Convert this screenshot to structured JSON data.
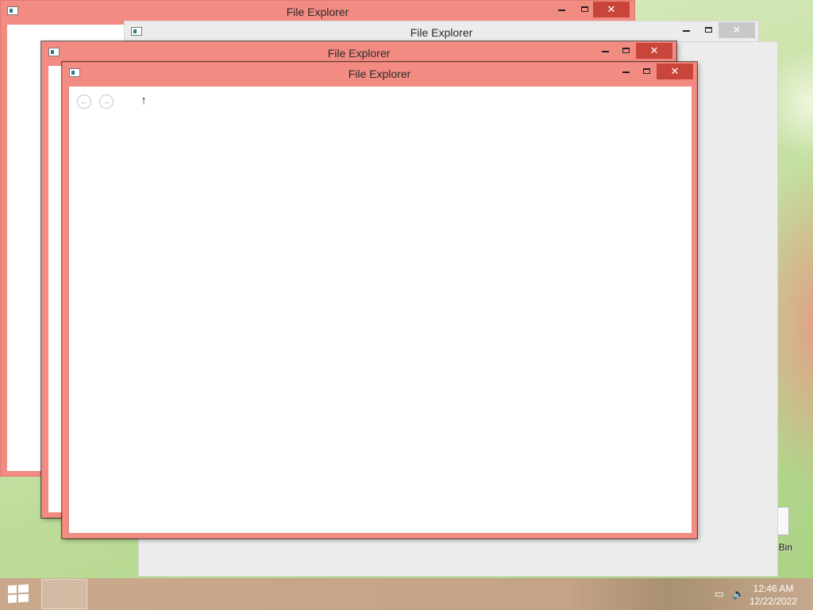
{
  "windows": [
    {
      "title": "File Explorer",
      "state": "active"
    },
    {
      "title": "File Explorer",
      "state": "inactive"
    },
    {
      "title": "File Explorer",
      "state": "active"
    },
    {
      "title": "File Explorer",
      "state": "active"
    }
  ],
  "title_controls": {
    "close_glyph": "✕"
  },
  "toolbar": {
    "back_glyph": "←",
    "forward_glyph": "→",
    "up_glyph": "↑"
  },
  "desktop": {
    "recycle_bin_label": "Recycle Bin",
    "recycle_bin_visible_label": "le Bin"
  },
  "taskbar": {
    "clock_time": "12:46 AM",
    "clock_date": "12/22/2022",
    "tray_icons": [
      "network-icon",
      "volume-icon"
    ]
  },
  "colors": {
    "active_frame": "#f28b82",
    "inactive_frame": "#ececec",
    "close_active": "#c9453b",
    "taskbar": "#c9a88b"
  }
}
